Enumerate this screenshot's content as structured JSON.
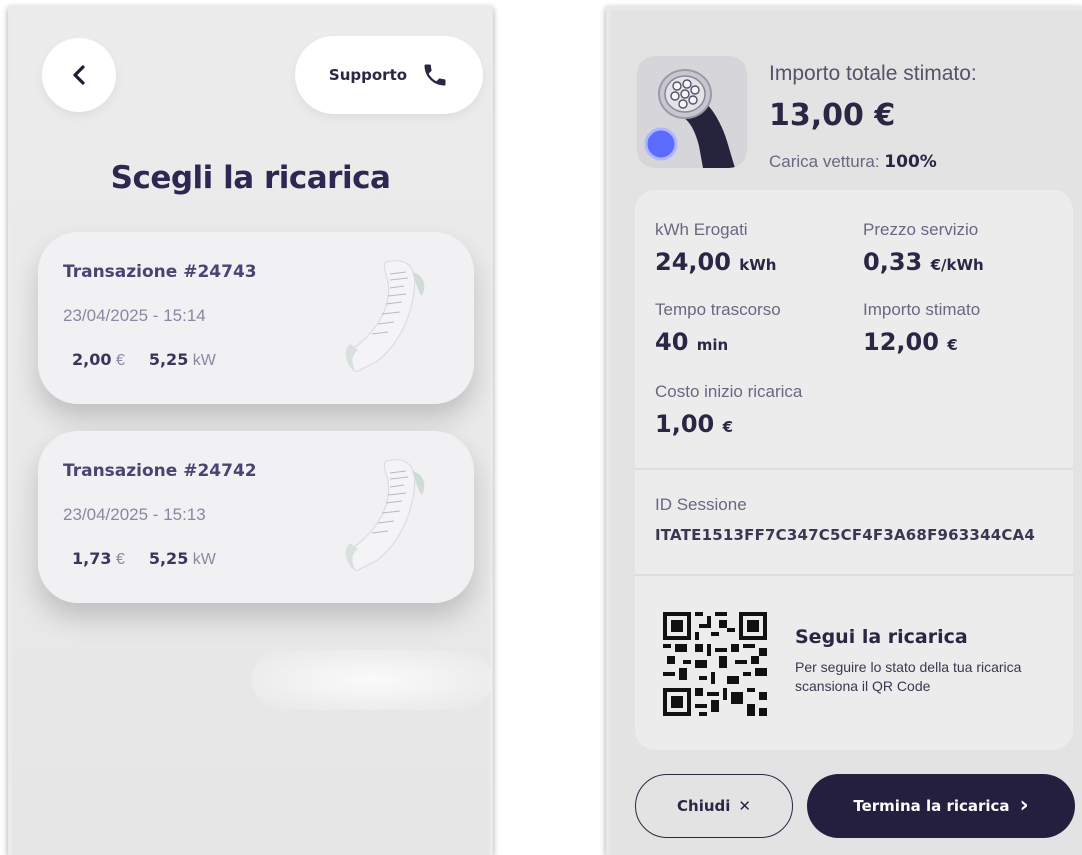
{
  "left_screen": {
    "back_icon": "chevron-left-icon",
    "support": {
      "label": "Supporto",
      "icon": "phone-icon"
    },
    "title": "Scegli la ricarica",
    "transactions": [
      {
        "title": "Transazione #24743",
        "datetime": "23/04/2025 - 15:14",
        "amount": "2,00",
        "currency": "€",
        "power": "5,25",
        "power_unit": "kW"
      },
      {
        "title": "Transazione #24742",
        "datetime": "23/04/2025 - 15:13",
        "amount": "1,73",
        "currency": "€",
        "power": "5,25",
        "power_unit": "kW"
      }
    ]
  },
  "right_screen": {
    "estimate_label": "Importo totale stimato:",
    "estimate_value": "13,00 €",
    "charge_label": "Carica vettura:",
    "charge_value": "100%",
    "metrics": {
      "kwh": {
        "label": "kWh Erogati",
        "value": "24,00",
        "unit": "kWh"
      },
      "price": {
        "label": "Prezzo servizio",
        "value": "0,33",
        "unit": "€/kWh"
      },
      "time": {
        "label": "Tempo trascorso",
        "value": "40",
        "unit": "min"
      },
      "estimated": {
        "label": "Importo stimato",
        "value": "12,00",
        "unit": "€"
      },
      "start_cost": {
        "label": "Costo inizio ricarica",
        "value": "1,00",
        "unit": "€"
      }
    },
    "session": {
      "label": "ID Sessione",
      "value": "ITATE1513FF7C347C5CF4F3A68F963344CA4"
    },
    "follow": {
      "title": "Segui la ricarica",
      "description": "Per seguire lo stato della tua ricarica scansiona il QR Code"
    },
    "buttons": {
      "close": "Chiudi",
      "close_icon": "✕",
      "end": "Termina la ricarica",
      "end_icon": "›"
    },
    "colors": {
      "primary": "#241f3f",
      "accent_dot": "#5b6cff"
    }
  }
}
